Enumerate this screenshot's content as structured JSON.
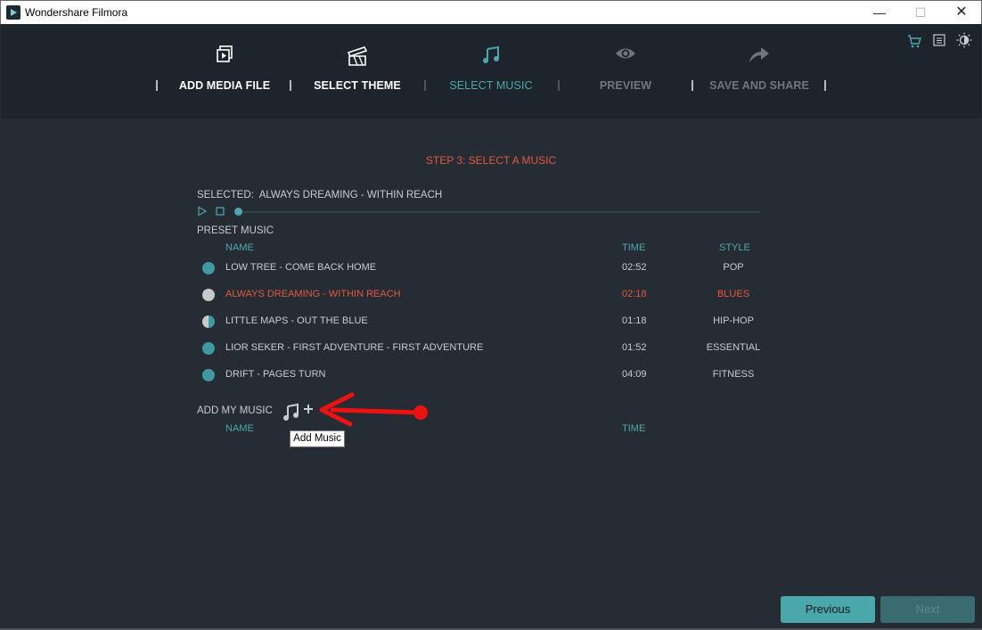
{
  "window": {
    "title": "Wondershare Filmora"
  },
  "header": {
    "steps": [
      {
        "label": "ADD MEDIA FILE",
        "icon": "add-media-icon",
        "state": "done"
      },
      {
        "label": "SELECT THEME",
        "icon": "theme-icon",
        "state": "done"
      },
      {
        "label": "SELECT MUSIC",
        "icon": "music-note-icon",
        "state": "active"
      },
      {
        "label": "PREVIEW",
        "icon": "eye-icon",
        "state": "disabled"
      },
      {
        "label": "SAVE AND SHARE",
        "icon": "share-arrow-icon",
        "state": "disabled"
      }
    ],
    "top_icons": [
      "cart-icon",
      "list-icon",
      "brightness-icon"
    ]
  },
  "main": {
    "step_title": "STEP 3: SELECT A MUSIC",
    "selected_label": "SELECTED:",
    "selected_value": "ALWAYS DREAMING - WITHIN REACH",
    "player": {
      "progress": 0.0
    },
    "preset_label": "PRESET MUSIC",
    "columns": {
      "name": "NAME",
      "time": "TIME",
      "style": "STYLE"
    },
    "preset": [
      {
        "name": "LOW TREE - COME BACK HOME",
        "time": "02:52",
        "style": "POP"
      },
      {
        "name": "ALWAYS DREAMING - WITHIN REACH",
        "time": "02:18",
        "style": "BLUES",
        "active": true
      },
      {
        "name": "LITTLE MAPS - OUT THE BLUE",
        "time": "01:18",
        "style": "HIP-HOP"
      },
      {
        "name": "LIOR SEKER - FIRST ADVENTURE - FIRST ADVENTURE",
        "time": "01:52",
        "style": "ESSENTIAL"
      },
      {
        "name": "DRIFT - PAGES TURN",
        "time": "04:09",
        "style": "FITNESS"
      }
    ],
    "my_music_label": "ADD MY MUSIC",
    "my_music_columns": {
      "name": "NAME",
      "time": "TIME"
    },
    "tooltip": "Add Music"
  },
  "footer": {
    "previous": "Previous",
    "next": "Next"
  },
  "colors": {
    "accent": "#4aa8ad",
    "highlight": "#e0583f",
    "background": "#262c34",
    "header": "#1e242b"
  }
}
